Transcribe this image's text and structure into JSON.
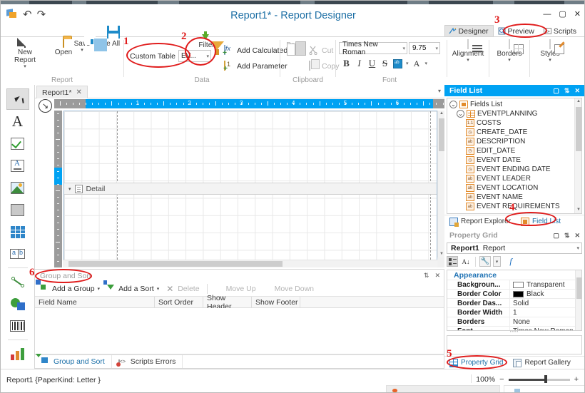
{
  "window": {
    "title_doc": "Report1*",
    "title_sep": " - ",
    "title_app": "Report Designer",
    "minimize": "—",
    "maximize": "▢",
    "close": "✕",
    "app_icon": "report-designer-logo",
    "undo": "↶",
    "redo": "↷"
  },
  "view_tabs": [
    {
      "label": "Designer",
      "icon": "designer-icon",
      "active": true
    },
    {
      "label": "Preview",
      "icon": "preview-icon",
      "active": false
    },
    {
      "label": "Scripts",
      "icon": "scripts-icon",
      "active": false
    }
  ],
  "ribbon": {
    "groups": [
      {
        "name": "Report",
        "label": "Report"
      },
      {
        "name": "Data",
        "label": "Data"
      },
      {
        "name": "Clipboard",
        "label": "Clipboard"
      },
      {
        "name": "Font",
        "label": "Font"
      }
    ],
    "report": {
      "new_report": "New Report",
      "open": "Open",
      "save": "Save",
      "save_all": "Save All",
      "caret": "▾"
    },
    "data": {
      "custom_table_label": "Custom Table",
      "custom_table_value": "EV...",
      "custom_table_caret": "▾",
      "filters": "Filters",
      "add_calculated_field": "Add Calculated Field",
      "add_parameter": "Add Parameter"
    },
    "clipboard": {
      "paste": "Paste",
      "cut": "Cut",
      "copy": "Copy"
    },
    "font": {
      "family": "Times New Roman",
      "size": "9.75",
      "caret": "▾",
      "bold": "B",
      "italic": "I",
      "underline": "U",
      "strike": "S",
      "highlight": "ab",
      "fore_color": "A"
    },
    "alignment": {
      "label": "Alignment",
      "caret": "▾"
    },
    "borders": {
      "label": "Borders",
      "caret": "▾"
    },
    "styles": {
      "label": "Styles",
      "caret": "▾"
    }
  },
  "toolbox": {
    "items": [
      {
        "name": "pointer-tool",
        "icon": "cursor-icon",
        "selected": true
      },
      {
        "name": "label-tool",
        "icon": "letter-a-icon",
        "selected": false
      },
      {
        "name": "check-box-tool",
        "icon": "checkbox-icon",
        "selected": false
      },
      {
        "name": "rich-text-tool",
        "icon": "rich-text-icon",
        "selected": false
      },
      {
        "name": "picture-box-tool",
        "icon": "picture-icon",
        "selected": false
      },
      {
        "name": "panel-tool",
        "icon": "panel-icon",
        "selected": false
      },
      {
        "name": "table-tool",
        "icon": "table-icon",
        "selected": false
      },
      {
        "name": "character-comb-tool",
        "icon": "ab-cells-icon",
        "selected": false
      },
      {
        "name": "line-tool",
        "icon": "line-icon",
        "selected": false
      },
      {
        "name": "shape-tool",
        "icon": "shape-icon",
        "selected": false
      },
      {
        "name": "barcode-tool",
        "icon": "barcode-icon",
        "selected": false
      },
      {
        "name": "chart-tool",
        "icon": "bar-chart-icon",
        "selected": false
      },
      {
        "name": "gauge-tool",
        "icon": "gauge-icon",
        "selected": false
      }
    ],
    "more": "⊙"
  },
  "designer": {
    "doc_tab": "Report1*",
    "doc_tab_close": "✕",
    "tabs_caret": "▾",
    "corner_icon": "↘",
    "band_label": "Detail",
    "band_caret": "▾",
    "ruler_numbers": [
      "1",
      "2",
      "3",
      "4",
      "5",
      "6"
    ]
  },
  "group_and_sort": {
    "title": "Group and Sort",
    "pin": "⇅",
    "close": "✕",
    "toolbar": [
      {
        "label": "Add a Group",
        "icon": "add-group-icon",
        "caret": "▾",
        "disabled": false
      },
      {
        "label": "Add a Sort",
        "icon": "add-sort-icon",
        "caret": "▾",
        "disabled": false
      },
      {
        "label": "Delete",
        "icon": "delete-icon",
        "caret": "",
        "disabled": true
      },
      {
        "label": "Move Up",
        "icon": "move-up-icon",
        "caret": "",
        "disabled": true
      },
      {
        "label": "Move Down",
        "icon": "move-down-icon",
        "caret": "",
        "disabled": true
      }
    ],
    "columns": [
      "Field Name",
      "Sort Order",
      "Show Header",
      "Show Footer"
    ],
    "rows": [],
    "tabs": [
      {
        "label": "Group and Sort",
        "icon": "group-sort-icon",
        "active": true
      },
      {
        "label": "Scripts Errors",
        "icon": "scripts-errors-icon",
        "active": false
      }
    ]
  },
  "field_list": {
    "title": "Field List",
    "float": "▢",
    "pin": "⇅",
    "close": "✕",
    "root": {
      "label": "Fields List",
      "icon": "fields-list-icon",
      "expander": "⌄",
      "indent": 0
    },
    "table": {
      "label": "EVENTPLANNING",
      "icon": "table-icon",
      "expander": "⌄",
      "indent": 1
    },
    "fields": [
      {
        "label": "COSTS",
        "type": "1.1",
        "icon": "number-field-icon"
      },
      {
        "label": "CREATE_DATE",
        "type": "◷",
        "icon": "date-field-icon"
      },
      {
        "label": "DESCRIPTION",
        "type": "ab",
        "icon": "string-field-icon"
      },
      {
        "label": "EDIT_DATE",
        "type": "◷",
        "icon": "date-field-icon"
      },
      {
        "label": "EVENT DATE",
        "type": "◷",
        "icon": "date-field-icon"
      },
      {
        "label": "EVENT ENDING DATE",
        "type": "◷",
        "icon": "date-field-icon"
      },
      {
        "label": "EVENT LEADER",
        "type": "ab",
        "icon": "string-field-icon"
      },
      {
        "label": "EVENT LOCATION",
        "type": "ab",
        "icon": "string-field-icon"
      },
      {
        "label": "EVENT NAME",
        "type": "ab",
        "icon": "string-field-icon"
      },
      {
        "label": "EVENT REQUIREMENTS",
        "type": "ab",
        "icon": "string-field-icon"
      }
    ],
    "tabs": [
      {
        "label": "Report Explorer",
        "icon": "report-explorer-icon",
        "active": false
      },
      {
        "label": "Field List",
        "icon": "field-list-icon",
        "active": true
      }
    ]
  },
  "property_grid": {
    "title": "Property Grid",
    "float": "▢",
    "pin": "⇅",
    "close": "✕",
    "selector_object": "Report1",
    "selector_type": "Report",
    "selector_caret": "▾",
    "toolbar": {
      "categorized": "categorized-icon",
      "alphabetical": "sort-az-icon",
      "actions": "wrench-icon",
      "actions_caret": "▾",
      "expressions": "fx-icon"
    },
    "category": {
      "label": "Appearance",
      "caret": "▴"
    },
    "rows": [
      {
        "key": "Backgroun...",
        "value": "Transparent",
        "swatch": "#ffffff"
      },
      {
        "key": "Border Color",
        "value": "Black",
        "swatch": "#000000"
      },
      {
        "key": "Border Das...",
        "value": "Solid",
        "swatch": ""
      },
      {
        "key": "Border Width",
        "value": "1",
        "swatch": ""
      },
      {
        "key": "Borders",
        "value": "None",
        "swatch": ""
      },
      {
        "key": "Font",
        "value": "Times New Roman,...",
        "swatch": ""
      }
    ],
    "tabs": [
      {
        "label": "Property Grid",
        "icon": "property-grid-icon",
        "active": true
      },
      {
        "label": "Report Gallery",
        "icon": "report-gallery-icon",
        "active": false
      }
    ]
  },
  "status_bar": {
    "text": "Report1 {PaperKind: Letter }",
    "zoom_percent": "100%",
    "zoom_out": "−",
    "zoom_in": "+"
  },
  "annotations": [
    {
      "number": "1",
      "target": "custom-table-combo"
    },
    {
      "number": "2",
      "target": "filters-button"
    },
    {
      "number": "3",
      "target": "preview-tab"
    },
    {
      "number": "4",
      "target": "field-list-tab"
    },
    {
      "number": "5",
      "target": "property-grid-tab"
    },
    {
      "number": "6",
      "target": "group-and-sort-title"
    }
  ],
  "colors": {
    "accent_blue": "#00a2f3",
    "title_blue": "#1d6fa5",
    "annotation_red": "#e01b1b",
    "ribbon_bg": "#ffffff"
  }
}
